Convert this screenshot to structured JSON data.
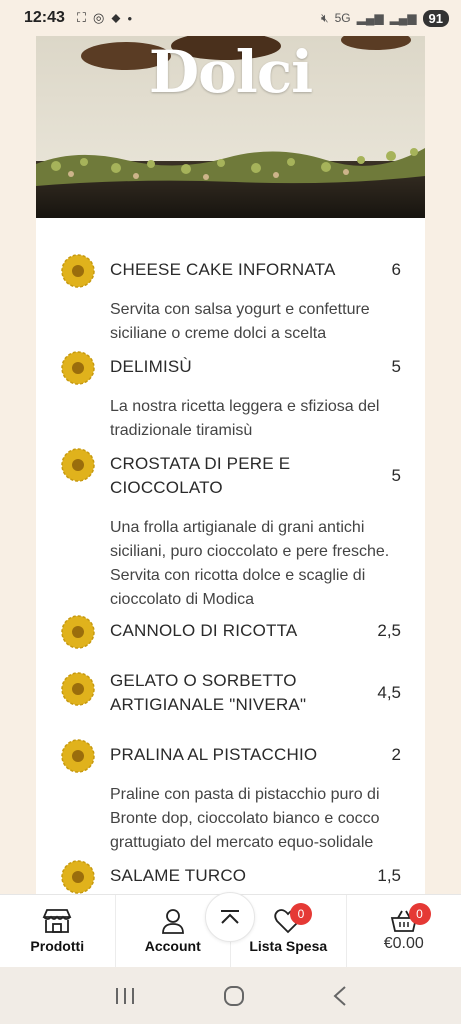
{
  "status_bar": {
    "time": "12:43",
    "network": "5G",
    "battery": "91"
  },
  "page": {
    "title": "Dolci"
  },
  "menu_items": [
    {
      "name": "CHEESE CAKE INFORNATA",
      "price": "6",
      "description": "Servita con salsa yogurt e confetture siciliane o creme dolci a scelta"
    },
    {
      "name": "DELIMISÙ",
      "price": "5",
      "description": "La nostra ricetta leggera e sfiziosa del tradizionale tiramisù"
    },
    {
      "name": "CROSTATA DI PERE E CIOCCOLATO",
      "price": "5",
      "description": "Una frolla artigianale di grani antichi siciliani, puro cioccolato e pere fresche. Servita con ricotta dolce e scaglie di cioccolato di Modica"
    },
    {
      "name": "CANNOLO DI RICOTTA",
      "price": "2,5",
      "description": ""
    },
    {
      "name": "GELATO O SORBETTO ARTIGIANALE \"NIVERA\"",
      "price": "4,5",
      "description": ""
    },
    {
      "name": "PRALINA AL PISTACCHIO",
      "price": "2",
      "description": "Praline con pasta di pistacchio puro di Bronte dop, cioccolato bianco e cocco grattugiato del mercato equo-solidale"
    },
    {
      "name": "SALAME TURCO",
      "price": "1,5",
      "description": ""
    }
  ],
  "bottom_nav": {
    "products_label": "Prodotti",
    "account_label": "Account",
    "wishlist_label": "Lista Spesa",
    "wishlist_count": "0",
    "cart_count": "0",
    "cart_total": "€0.00"
  },
  "colors": {
    "background": "#f8efe4",
    "badge": "#e53935",
    "flower": "#e0b21c"
  }
}
